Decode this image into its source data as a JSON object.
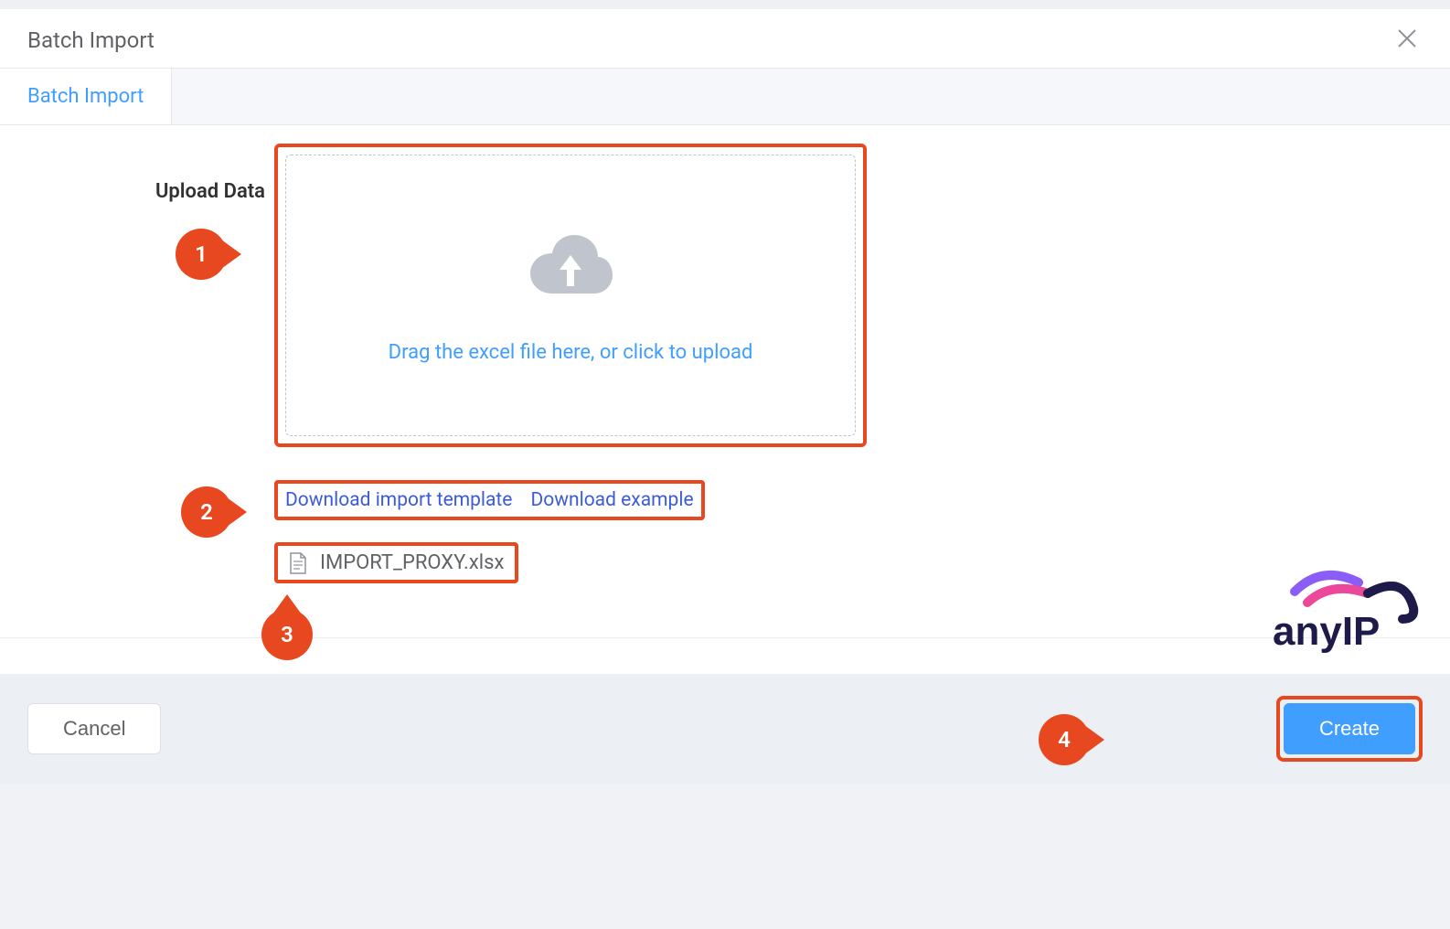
{
  "dialog": {
    "title": "Batch Import"
  },
  "tabs": {
    "active": "Batch Import"
  },
  "upload": {
    "label": "Upload Data",
    "dropzone_text": "Drag the excel file here, or click to upload"
  },
  "links": {
    "template": "Download import template",
    "example": "Download example"
  },
  "file": {
    "name": "IMPORT_PROXY.xlsx"
  },
  "callouts": {
    "c1": "1",
    "c2": "2",
    "c3": "3",
    "c4": "4"
  },
  "footer": {
    "cancel": "Cancel",
    "create": "Create"
  },
  "brand": {
    "name": "anyIP"
  }
}
